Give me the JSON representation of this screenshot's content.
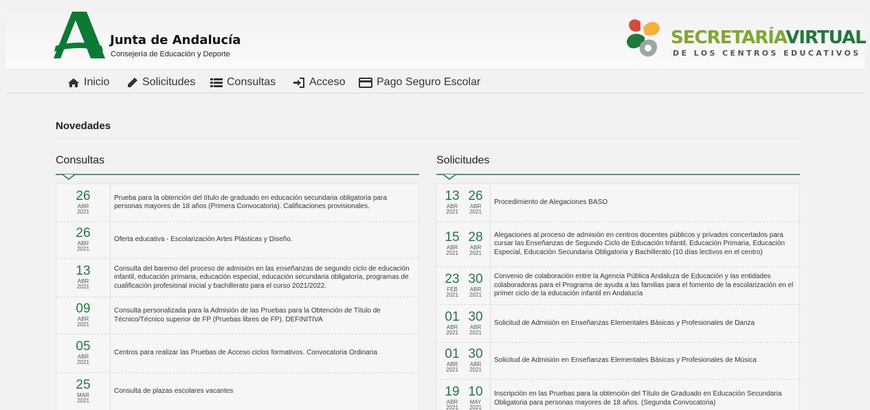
{
  "brand": {
    "title": "Junta de Andalucía",
    "subtitle": "Consejería de Educación y Deporte",
    "sv_title_a": "SECRETARÍA",
    "sv_title_b": "VIRTUAL",
    "sv_subtitle": "DE LOS CENTROS EDUCATIVOS"
  },
  "nav": {
    "items": [
      {
        "label": "Inicio",
        "icon": "home-icon"
      },
      {
        "label": "Solicitudes",
        "icon": "pencil-icon"
      },
      {
        "label": "Consultas",
        "icon": "list-icon"
      },
      {
        "label": "Acceso",
        "icon": "sign-in-icon"
      },
      {
        "label": "Pago Seguro Escolar",
        "icon": "credit-card-icon"
      }
    ]
  },
  "section_title": "Novedades",
  "consultas": {
    "title": "Consultas",
    "items": [
      {
        "day": "26",
        "month": "ABR",
        "year": "2021",
        "text": "Prueba para la obtención del título de graduado en educación secundaria obligatoria para personas mayores de 18 años (Primera Convocatoria). Calificaciones provisionales."
      },
      {
        "day": "26",
        "month": "ABR",
        "year": "2021",
        "text": "Oferta educativa - Escolarización Artes Plásticas y Diseño."
      },
      {
        "day": "13",
        "month": "ABR",
        "year": "2021",
        "text": "Consulta del baremo del proceso de admisión en las enseñanzas de segundo ciclo de educación infantil, educación primaria, educación especial, educación secundaria obligatoria, programas de cualificación profesional inicial y bachillerato para el curso 2021/2022."
      },
      {
        "day": "09",
        "month": "ABR",
        "year": "2021",
        "text": "Consulta personalizada para la Admisión de las Pruebas para la Obtención de Título de Técnico/Técnico superior de FP (Pruebas libres de FP). DEFINITIVA"
      },
      {
        "day": "05",
        "month": "ABR",
        "year": "2021",
        "text": "Centros para realizar las Pruebas de Acceso ciclos formativos. Convocatoria Ordinaria"
      },
      {
        "day": "25",
        "month": "MAR",
        "year": "2021",
        "text": "Consulta de plazas escolares vacantes"
      }
    ]
  },
  "solicitudes": {
    "title": "Solicitudes",
    "items": [
      {
        "start": {
          "day": "13",
          "month": "ABR",
          "year": "2021"
        },
        "end": {
          "day": "26",
          "month": "ABR",
          "year": "2021"
        },
        "text": "Procedimiento de Alegaciones BASO"
      },
      {
        "start": {
          "day": "15",
          "month": "ABR",
          "year": "2021"
        },
        "end": {
          "day": "28",
          "month": "ABR",
          "year": "2021"
        },
        "text": "Alegaciones al proceso de admisión en centros docentes públicos y privados concertados para cursar las Enseñanzas de Segundo Ciclo de Educación Infantil, Educación Primaria, Educación Especial, Educación Secundaria Obligatoria y Bachillerato (10 días lectivos en el centro)"
      },
      {
        "start": {
          "day": "23",
          "month": "FEB",
          "year": "2021"
        },
        "end": {
          "day": "30",
          "month": "ABR",
          "year": "2021"
        },
        "text": "Convenio de colaboración entre la Agencia Pública Andaluza de Educación y las entidades colaboradoras para el Programa de ayuda a las familias para el fomento de la escolarización en el primer ciclo de la educación infantil en Andalucía"
      },
      {
        "start": {
          "day": "01",
          "month": "ABR",
          "year": "2021"
        },
        "end": {
          "day": "30",
          "month": "ABR",
          "year": "2021"
        },
        "text": "Solicitud de Admisión en Enseñanzas Elementales Básicas y Profesionales de Danza"
      },
      {
        "start": {
          "day": "01",
          "month": "ABR",
          "year": "2021"
        },
        "end": {
          "day": "30",
          "month": "ABR",
          "year": "2021"
        },
        "text": "Solicitud de Admisión en Enseñanzas Elementales Básicas y Profesionales de Música"
      },
      {
        "start": {
          "day": "19",
          "month": "ABR",
          "year": "2021"
        },
        "end": {
          "day": "10",
          "month": "MAY",
          "year": "2021"
        },
        "text": "Inscripción en las Pruebas para la obtención del Título de Graduado en Educación Secundaria Obligatoria para personas mayores de 18 años. (Segunda Convocatoria)"
      }
    ]
  },
  "colors": {
    "brand_green": "#1f7a3c",
    "light_green": "#80a830"
  }
}
